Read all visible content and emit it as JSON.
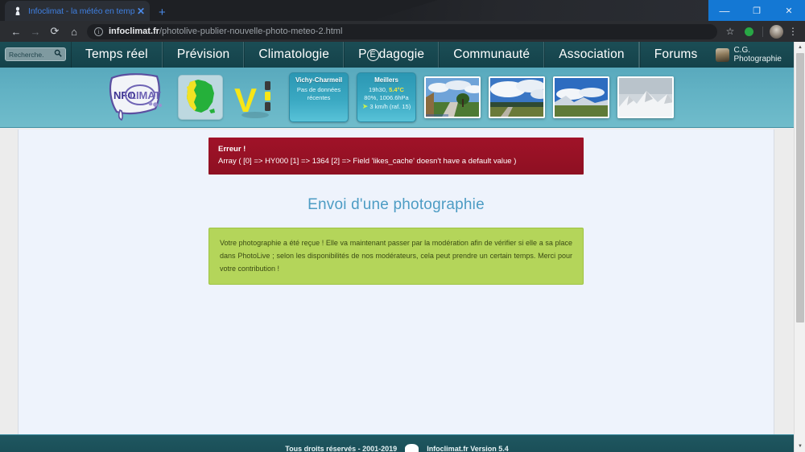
{
  "browser": {
    "tab": {
      "title": "Infoclimat - la météo en temps ré",
      "favicon": "infoclimat-favicon",
      "close_label": "✕"
    },
    "newtab_label": "+",
    "window_controls": {
      "minimize": "—",
      "maximize": "❐",
      "close": "✕"
    },
    "toolbar": {
      "back": "←",
      "forward": "→",
      "reload": "⟳",
      "home": "⌂",
      "url_domain": "infoclimat.fr",
      "url_path": "/photolive-publier-nouvelle-photo-meteo-2.html",
      "info_icon": "ⓘ",
      "star": "☆",
      "kebab": "⋮"
    }
  },
  "site": {
    "search": {
      "placeholder": "Recherche.",
      "icon": "search-icon"
    },
    "nav_items": [
      {
        "label": "Temps réel"
      },
      {
        "label": "Prévision"
      },
      {
        "label": "Climatologie"
      },
      {
        "label": "Pédagogie",
        "special": "circled-e"
      },
      {
        "label": "Communauté"
      },
      {
        "label": "Association"
      },
      {
        "label": "Forums"
      }
    ],
    "user": {
      "name": "C.G. Photographie",
      "caret": "▾"
    },
    "header": {
      "logo_text_1": "NFO",
      "logo_text_2": "LIMAT",
      "vi_label": "Vi",
      "widgets": [
        {
          "title": "Vichy-Charmeil",
          "lines": [
            "Pas de données",
            "récentes"
          ],
          "has_data": false
        },
        {
          "title": "Meillers",
          "time": "19h30,",
          "temp": "5.4°C",
          "humidity_pressure": "80%, 1006.6hPa",
          "wind": "3 km/h (raf. 15)",
          "wind_arrow": "➤",
          "has_data": true
        }
      ],
      "thumbnails": [
        {
          "alt": "paysage-route-arbres"
        },
        {
          "alt": "paysage-nuages-champ"
        },
        {
          "alt": "paysage-montagne-prairie"
        },
        {
          "alt": "paysage-montagne-enneigee"
        }
      ]
    },
    "content": {
      "error": {
        "title": "Erreur !",
        "body": "Array ( [0] => HY000 [1] => 1364 [2] => Field 'likes_cache' doesn't have a default value )"
      },
      "page_title": "Envoi d'une photographie",
      "success_message": "Votre photographie a été reçue ! Elle va maintenant passer par la modération afin de vérifier si elle a sa place dans PhotoLive ; selon les disponibilités de nos modérateurs, cela peut prendre un certain temps. Merci pour votre contribution !"
    },
    "footer": {
      "left_note": "",
      "copyright": "Tous droits réservés - 2001-2019",
      "version": "Infoclimat.fr Version 5.4",
      "right_note": ""
    }
  },
  "scrollbar": {
    "up_arrow": "▲",
    "down_arrow": "▼"
  },
  "colors": {
    "nav_dark": "#184850",
    "header_blue": "#62b2c4",
    "error_red": "#9e1124",
    "success_green": "#b4d55a",
    "title_blue": "#4d9cc4",
    "accent_yellow": "#f5e73f"
  }
}
